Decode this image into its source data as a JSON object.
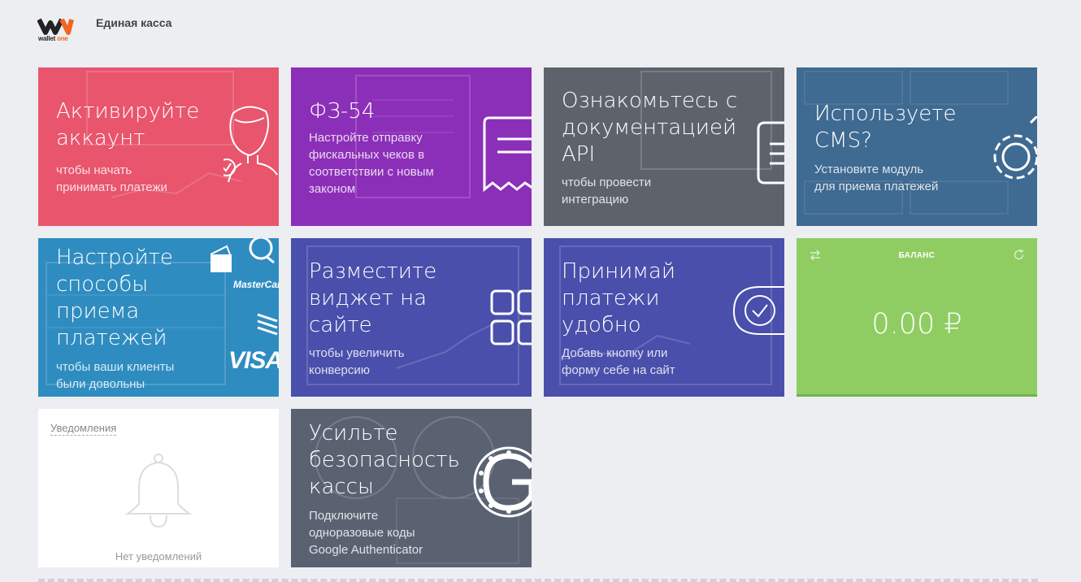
{
  "header": {
    "logo_text": "wallet",
    "logo_text_accent": "one",
    "app_title": "Единая касса"
  },
  "tiles": {
    "activate": {
      "title_1": "Активируйте",
      "title_2": "аккаунт",
      "sub_1": "чтобы начать",
      "sub_2": "принимать платежи",
      "color": "#e8556d"
    },
    "fz54": {
      "title": "ФЗ-54",
      "sub_1": "Настройте отправку",
      "sub_2": "фискальных чеков в",
      "sub_3": "соответствии с новым",
      "sub_4": "законом",
      "color": "#8c2fb8"
    },
    "docs": {
      "title_1": "Ознакомьтесь с",
      "title_2": "документацией",
      "title_3": "API",
      "sub_1": "чтобы провести",
      "sub_2": "интеграцию",
      "color": "#5e636b"
    },
    "cms": {
      "title_1": "Используете",
      "title_2": "CMS?",
      "sub_1": "Установите модуль",
      "sub_2": "для приема платежей",
      "color": "#3f6a91"
    },
    "methods": {
      "title_1": "Настройте",
      "title_2": "способы",
      "title_3": "приема",
      "title_4": "платежей",
      "sub_1": "чтобы ваши клиенты",
      "sub_2": "были довольны",
      "brand_1": "MasterCard",
      "brand_2": "VISA",
      "color": "#2f8cc0"
    },
    "widget": {
      "title_1": "Разместите",
      "title_2": "виджет на",
      "title_3": "сайте",
      "sub_1": "чтобы увеличить",
      "sub_2": "конверсию",
      "color": "#4a4fab"
    },
    "pay": {
      "title_1": "Принимай",
      "title_2": "платежи",
      "title_3": "удобно",
      "sub_1": "Добавь кнопку или",
      "sub_2": "форму себе на сайт",
      "color": "#4a4fab"
    },
    "balance": {
      "label": "БАЛАНС",
      "value": "0.00 ₽",
      "color": "#8fcd62"
    },
    "notifications": {
      "label": "Уведомления",
      "empty": "Нет уведомлений"
    },
    "security": {
      "title_1": "Усильте",
      "title_2": "безопасность",
      "title_3": "кассы",
      "sub_1": "Подключите",
      "sub_2": "одноразовые коды",
      "sub_3": "Google Authenticator",
      "color": "#5a6272"
    }
  },
  "icons": [
    "wallet-one-logo",
    "user-check-icon",
    "receipt-icon",
    "document-icon",
    "gear-icon",
    "wallet-icon",
    "mastercard-logo",
    "visa-logo",
    "grid-widget-icon",
    "check-circle-icon",
    "transfer-icon",
    "refresh-icon",
    "bell-icon",
    "google-authenticator-icon"
  ]
}
